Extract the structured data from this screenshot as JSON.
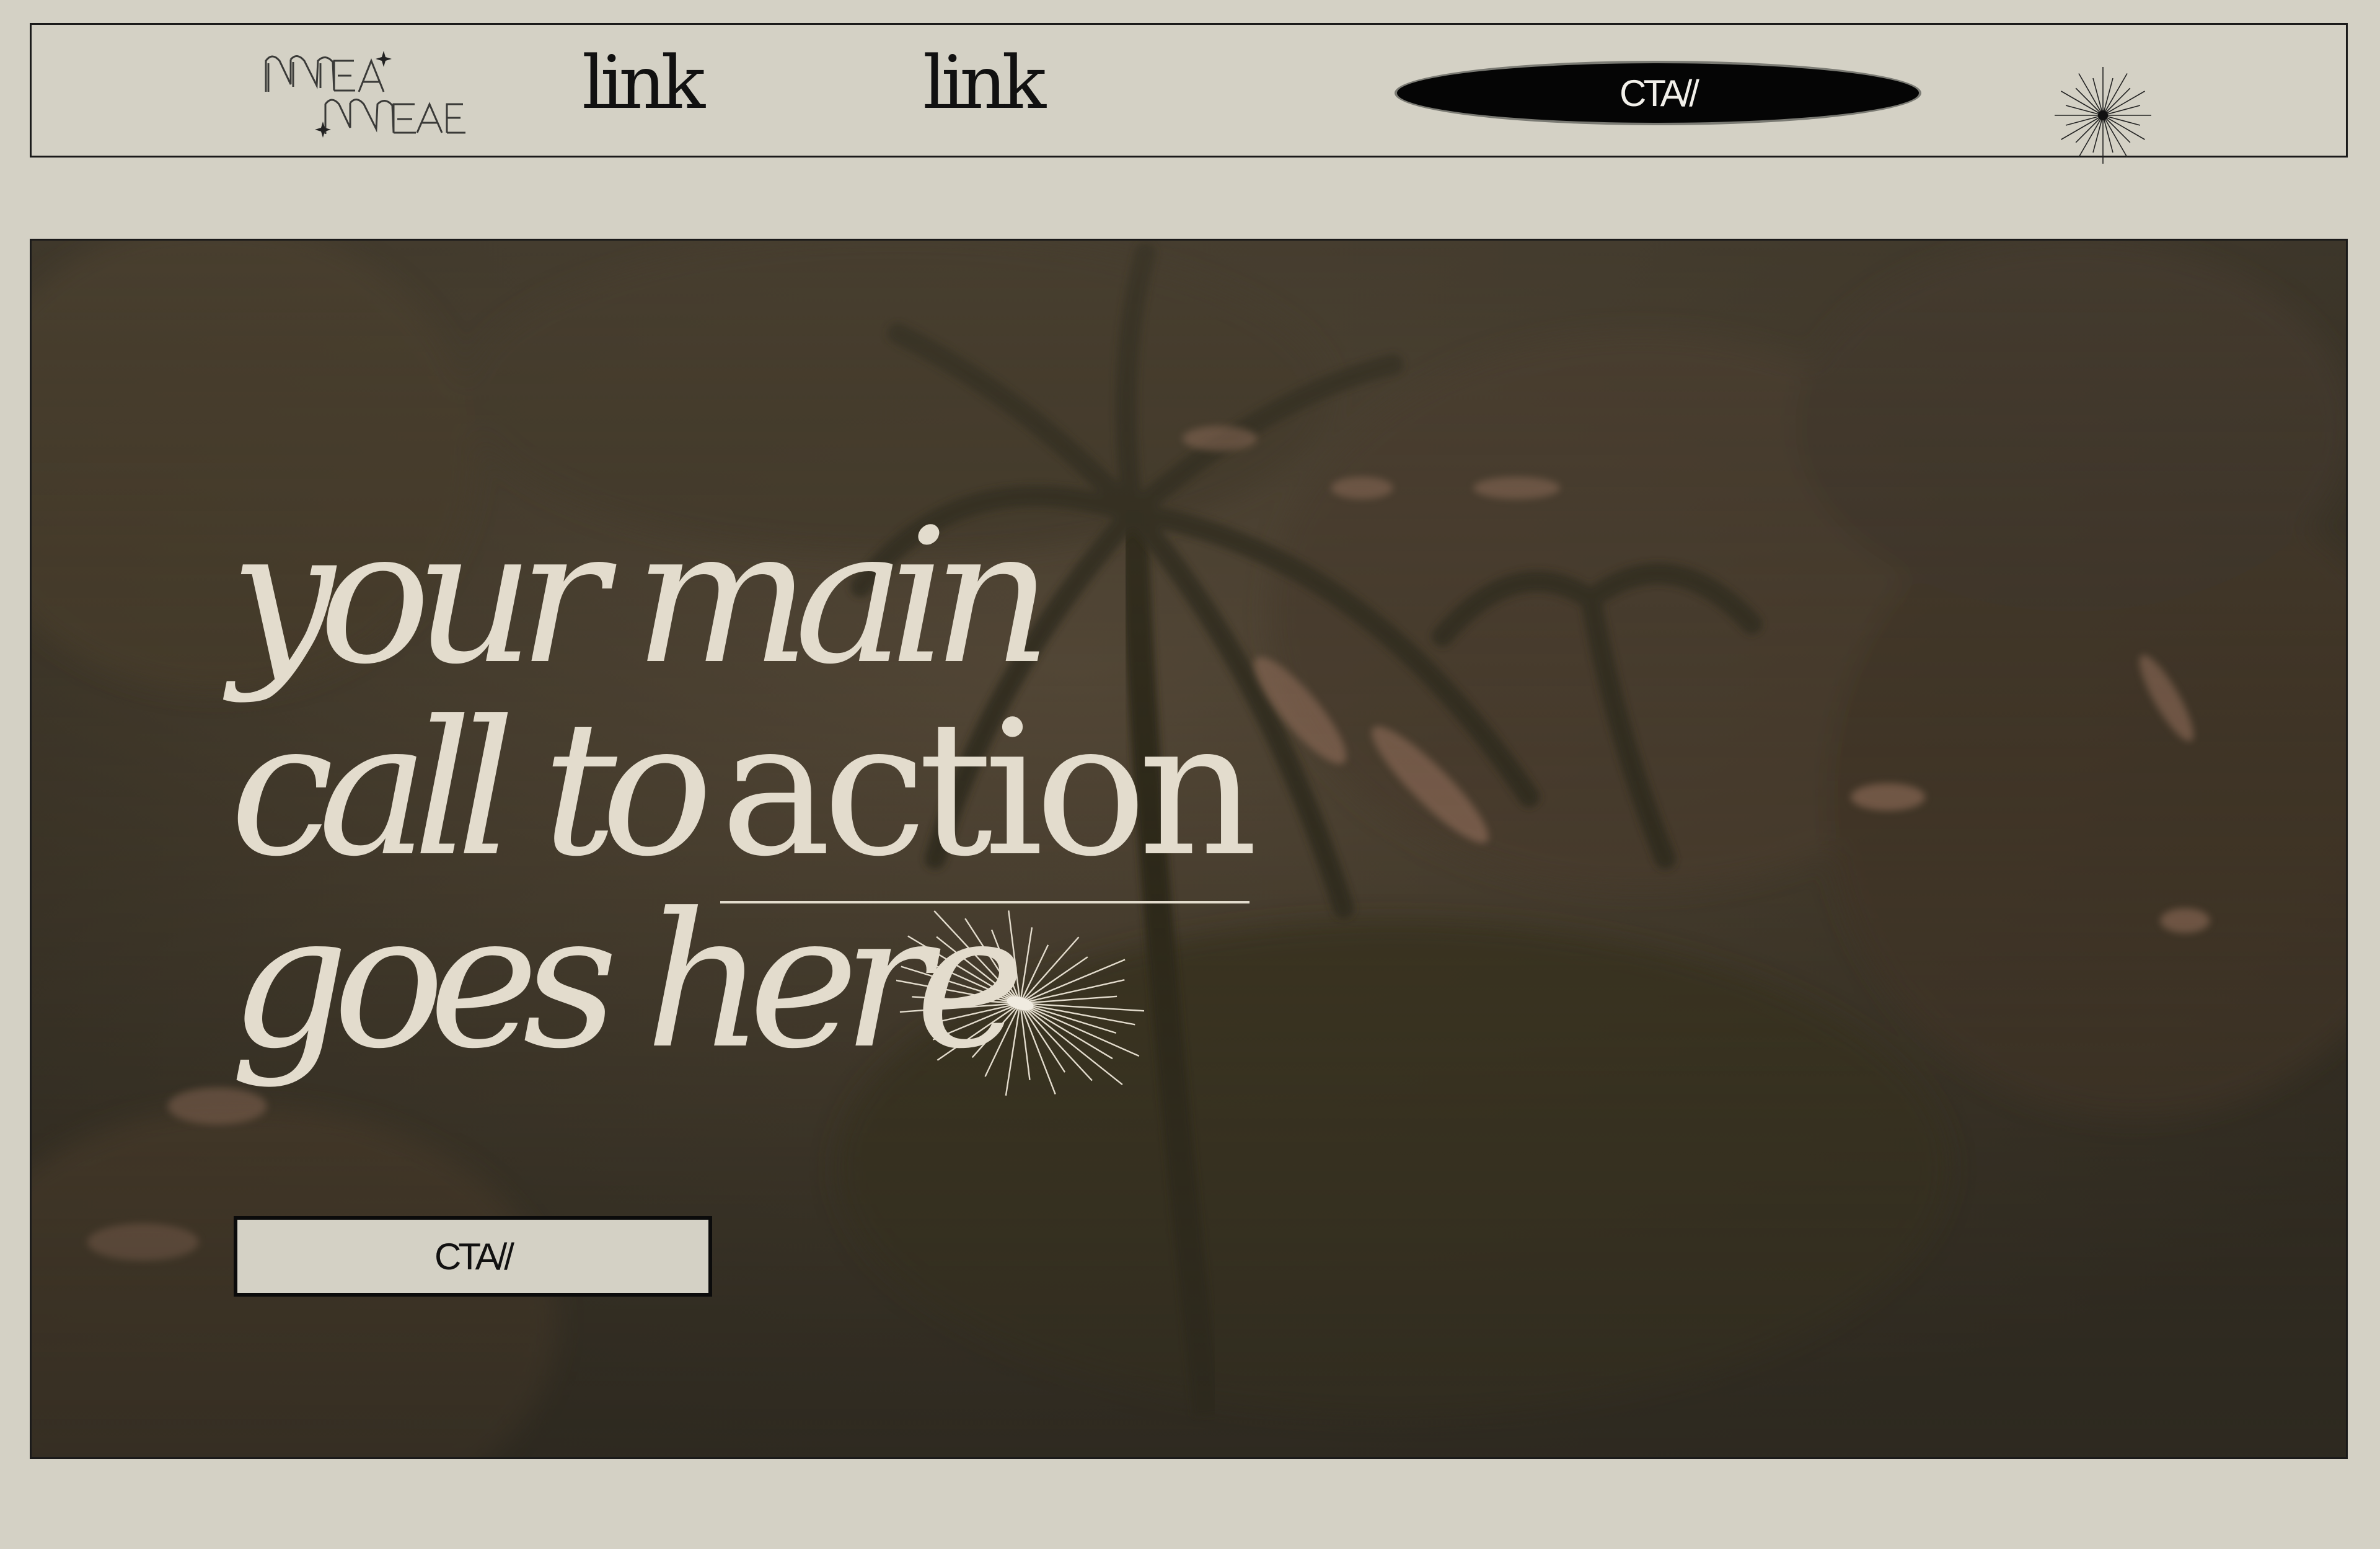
{
  "nav": {
    "logo_icon": "name-logo-icon",
    "links": [
      {
        "label": "link"
      },
      {
        "label": "link"
      }
    ],
    "cta_label": "CTA//",
    "star_icon": "starburst-icon"
  },
  "hero": {
    "headline": {
      "line1": "your main",
      "line2_italic": "call to",
      "line2_underlined": "action",
      "line3": "goes here"
    },
    "sparkle_icon": "sparkle-icon",
    "cta_label": "CTA//"
  },
  "colors": {
    "page_background": "#d4d1c5",
    "border": "#1a1a1a",
    "cta_dark": "#050505",
    "hero_text": "#e3dccd",
    "hero_photo_tone": "#3e3628"
  }
}
